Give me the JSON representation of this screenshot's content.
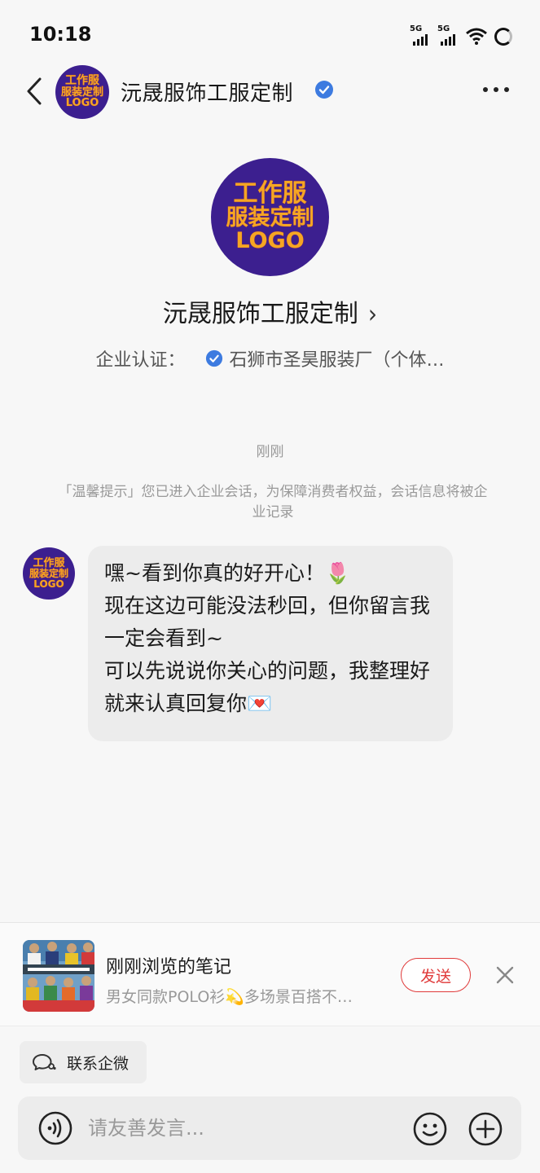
{
  "status_bar": {
    "time": "10:18",
    "signal1_label": "5G",
    "signal2_label": "5G",
    "icons": [
      "signal-icon",
      "signal-icon",
      "wifi-icon",
      "battery-icon"
    ]
  },
  "nav": {
    "title": "沅晟服饰工服定制",
    "back_icon": "chevron-left-icon",
    "verified_icon": "verified-badge-icon",
    "more_icon": "more-horizontal-icon"
  },
  "logo": {
    "line1": "工作服",
    "line2": "服装定制",
    "line3": "LOGO",
    "bg_color": "#3c1f8f",
    "text_color": "#f5a623"
  },
  "profile": {
    "name": "沅晟服饰工服定制",
    "chevron": "›",
    "cert_label": "企业认证：",
    "cert_value": "石狮市圣昊服装厂（个体…"
  },
  "chat": {
    "timestamp": "刚刚",
    "notice": "「温馨提示」您已进入企业会话，为保障消费者权益，会话信息将被企业记录",
    "message_lines": [
      "嘿~看到你真的好开心！🌷",
      "现在这边可能没法秒回，但你留言我一定会看到~",
      "可以先说说你关心的问题，我整理好就来认真回复你💌"
    ]
  },
  "recent_note": {
    "title": "刚刚浏览的笔记",
    "subtitle": "男女同款POLO衫💫多场景百搭不…",
    "send_label": "发送",
    "accent_color": "#e03b3b"
  },
  "contact_chip": {
    "label": "联系企微"
  },
  "input": {
    "placeholder": "请友善发言..."
  }
}
